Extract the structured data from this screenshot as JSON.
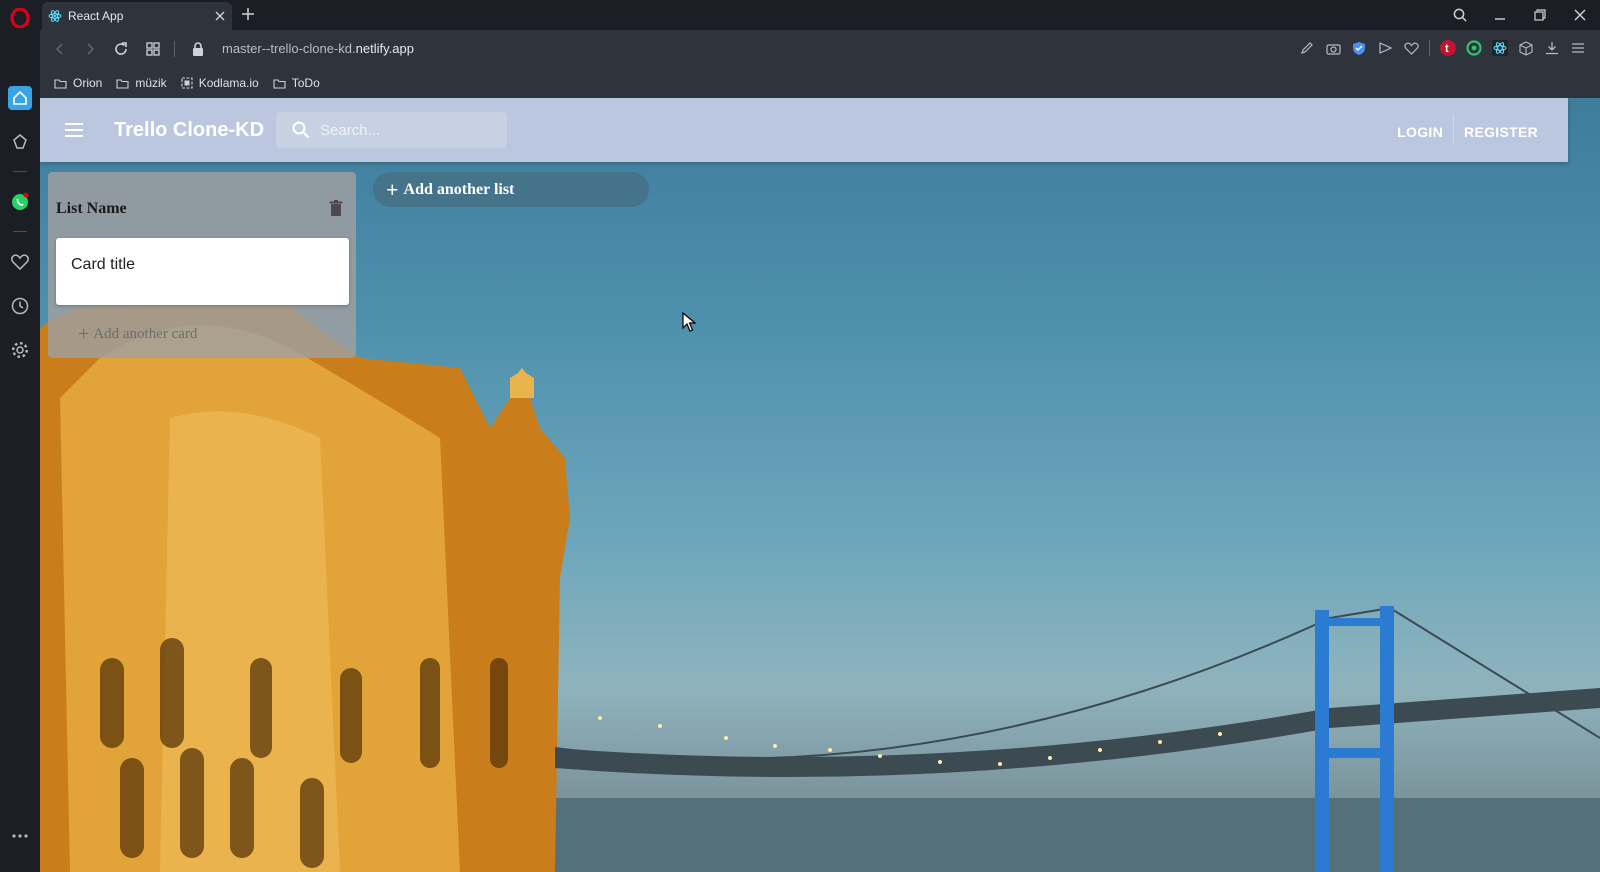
{
  "browser": {
    "tab_title": "React App",
    "url_prefix": "master--trello-clone-kd.",
    "url_domain": "netlify.app",
    "bookmarks": [
      {
        "label": "Orion",
        "icon": "folder-icon"
      },
      {
        "label": "müzik",
        "icon": "folder-icon"
      },
      {
        "label": "Kodlama.io",
        "icon": "page-icon"
      },
      {
        "label": "ToDo",
        "icon": "folder-icon"
      }
    ],
    "accent": "#d9001b"
  },
  "app": {
    "brand": "Trello Clone-KD",
    "search_placeholder": "Search...",
    "login_label": "LOGIN",
    "register_label": "REGISTER"
  },
  "board": {
    "lists": [
      {
        "name": "List Name",
        "cards": [
          {
            "title": "Card title"
          }
        ],
        "add_card_label": "Add another card"
      }
    ],
    "add_list_label": "Add another list"
  }
}
